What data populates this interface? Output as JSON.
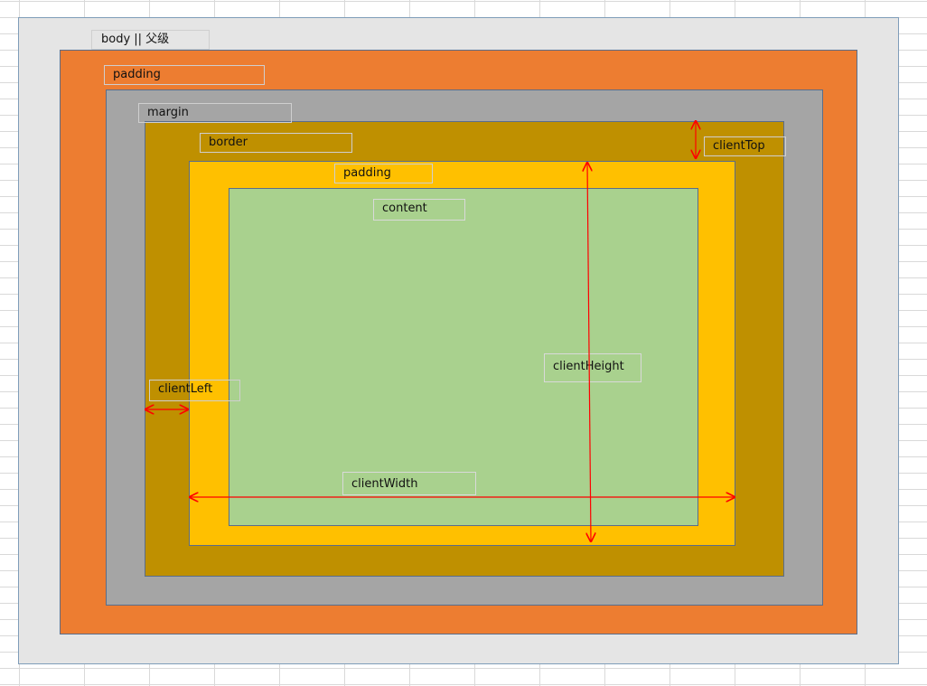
{
  "colors": {
    "body_bg": "#e5e5e5",
    "padding_outer": "#ed7d31",
    "margin": "#a5a5a5",
    "border": "#bf9000",
    "padding_inner": "#ffc000",
    "content": "#a9d18e",
    "arrow": "#ff0000"
  },
  "labels": {
    "body": "body || 父级",
    "padding_outer": "padding",
    "margin": "margin",
    "border": "border",
    "padding_inner": "padding",
    "content": "content",
    "client_top": "clientTop",
    "client_left": "clientLeft",
    "client_height": "clientHeight",
    "client_width": "clientWidth"
  }
}
